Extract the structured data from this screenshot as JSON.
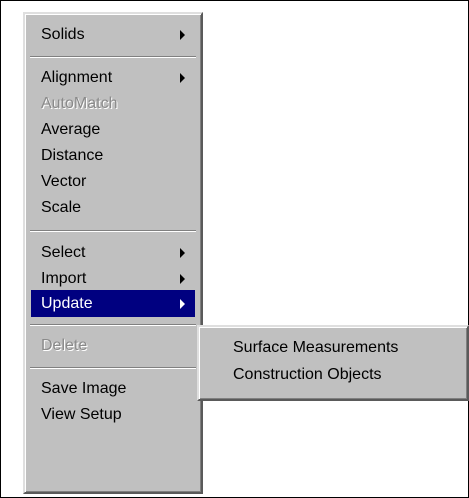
{
  "menu": {
    "items": [
      {
        "label": "Solids",
        "submenu": true,
        "disabled": false
      },
      {
        "label": "Alignment",
        "submenu": true,
        "disabled": false
      },
      {
        "label": "AutoMatch",
        "submenu": false,
        "disabled": true
      },
      {
        "label": "Average",
        "submenu": false,
        "disabled": false
      },
      {
        "label": "Distance",
        "submenu": false,
        "disabled": false
      },
      {
        "label": "Vector",
        "submenu": false,
        "disabled": false
      },
      {
        "label": "Scale",
        "submenu": false,
        "disabled": false
      },
      {
        "label": "Select",
        "submenu": true,
        "disabled": false
      },
      {
        "label": "Import",
        "submenu": true,
        "disabled": false
      },
      {
        "label": "Update",
        "submenu": true,
        "disabled": false,
        "selected": true
      },
      {
        "label": "Delete",
        "submenu": false,
        "disabled": true
      },
      {
        "label": "Save Image",
        "submenu": false,
        "disabled": false
      },
      {
        "label": "View Setup",
        "submenu": false,
        "disabled": false
      }
    ]
  },
  "submenu": {
    "items": [
      {
        "label": "Surface Measurements"
      },
      {
        "label": "Construction Objects"
      }
    ]
  },
  "colors": {
    "menu_background": "#c0c0c0",
    "highlight": "#000080",
    "disabled_text": "#8a8a8a"
  }
}
